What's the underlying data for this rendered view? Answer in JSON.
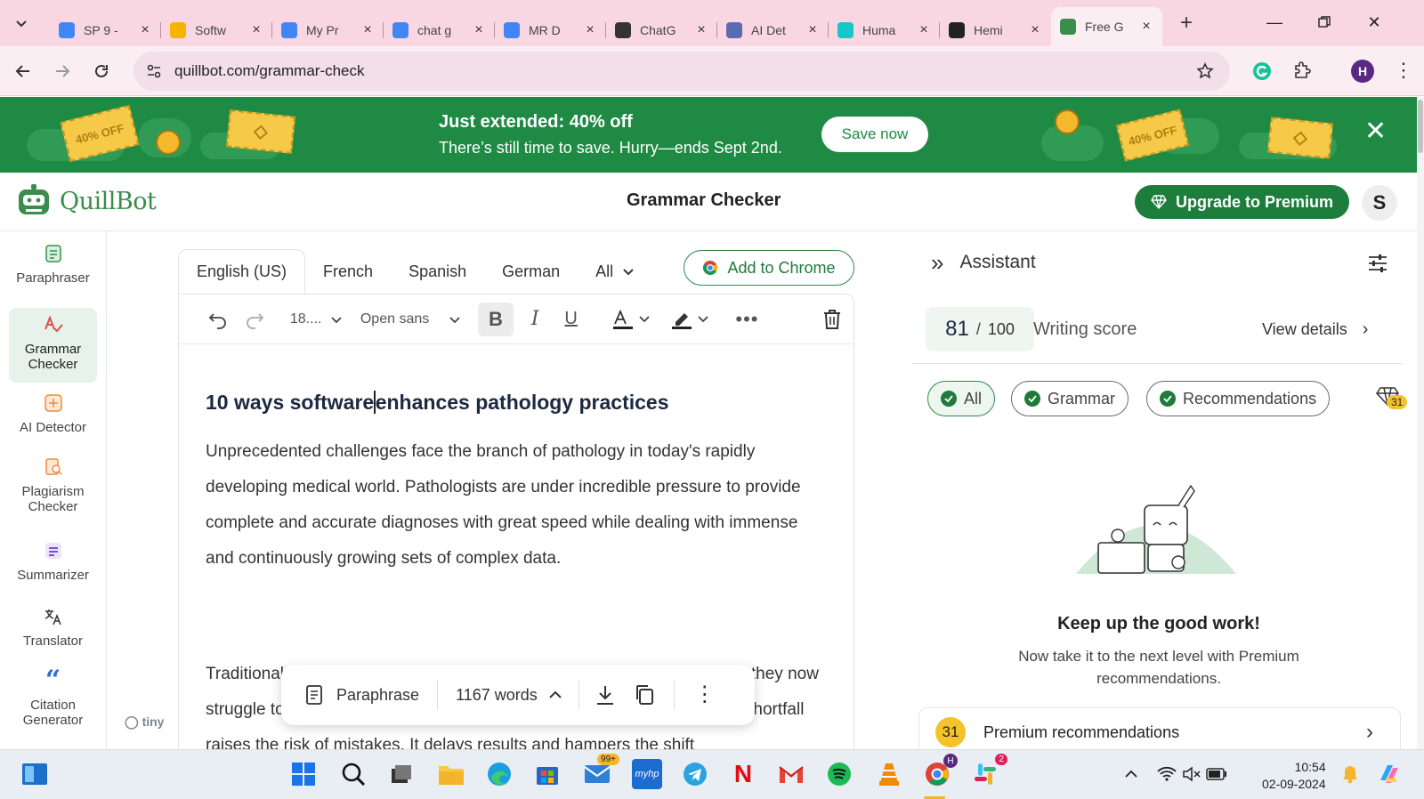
{
  "browser": {
    "tabs": [
      {
        "title": "SP 9 -",
        "icon": "google-g-icon",
        "color": "#4285f4"
      },
      {
        "title": "Softw",
        "icon": "notes-icon",
        "color": "#f4b400"
      },
      {
        "title": "My Pr",
        "icon": "google-docs-icon",
        "color": "#4285f4"
      },
      {
        "title": "chat g",
        "icon": "google-docs-icon",
        "color": "#4285f4"
      },
      {
        "title": "MR D",
        "icon": "google-docs-icon",
        "color": "#4285f4"
      },
      {
        "title": "ChatG",
        "icon": "openai-icon",
        "color": "#333333"
      },
      {
        "title": "AI Det",
        "icon": "ai-detector-icon",
        "color": "#5b6bb0"
      },
      {
        "title": "Huma",
        "icon": "humanizer-icon",
        "color": "#18c5c9"
      },
      {
        "title": "Hemi",
        "icon": "hemingway-icon",
        "color": "#222222"
      },
      {
        "title": "Free G",
        "icon": "quillbot-icon",
        "color": "#3a8d4a"
      }
    ],
    "url": "quillbot.com/grammar-check",
    "profile_initial": "H"
  },
  "banner": {
    "headline": "Just extended: 40% off",
    "subline": "There’s still time to save. Hurry—ends Sept 2nd.",
    "cta": "Save now",
    "ticket_text": "40% OFF"
  },
  "header": {
    "brand": "QuillBot",
    "title": "Grammar Checker",
    "upgrade": "Upgrade to Premium",
    "avatar": "S"
  },
  "sidebar": {
    "items": [
      {
        "label": "Paraphraser",
        "icon": "paraphraser-icon"
      },
      {
        "label": "Grammar Checker",
        "icon": "grammar-checker-icon"
      },
      {
        "label": "AI Detector",
        "icon": "ai-detector-icon"
      },
      {
        "label": "Plagiarism Checker",
        "icon": "plagiarism-checker-icon"
      },
      {
        "label": "Summarizer",
        "icon": "summarizer-icon"
      },
      {
        "label": "Translator",
        "icon": "translator-icon"
      },
      {
        "label": "Citation Generator",
        "icon": "citation-icon"
      }
    ],
    "tiny_label": "tiny"
  },
  "editor": {
    "languages": [
      "English (US)",
      "French",
      "Spanish",
      "German",
      "All"
    ],
    "add_chrome": "Add to Chrome",
    "font_size": "18....",
    "font_family": "Open sans",
    "heading_before_caret": "10 ways software",
    "heading_after_caret": "enhances pathology practices",
    "paragraph1": "Unprecedented challenges face the branch of pathology in today's rapidly developing medical world. Pathologists are under incredible pressure to provide complete and accurate diagnoses with great speed while dealing with immense and continuously growing sets of complex data.",
    "paragraph2": "Traditional methods were once the cornerstone of diagnostics. However, they now struggle to keep pace with the demands of modern pathology labs. This shortfall raises the risk of mistakes. It delays results and hampers the shift",
    "paraphrase": "Paraphrase",
    "word_count": "1167 words"
  },
  "assistant": {
    "title": "Assistant",
    "score": "81",
    "score_max": "100",
    "score_label": "Writing score",
    "view_details": "View details",
    "filters": [
      "All",
      "Grammar",
      "Recommendations"
    ],
    "premium_count": "31",
    "keep_title": "Keep up the good work!",
    "keep_sub": "Now take it to the next level with Premium recommendations.",
    "premium_rec": "Premium recommendations"
  },
  "taskbar": {
    "mail_badge": "99+",
    "slack_badge": "2",
    "time": "10:54",
    "date": "02-09-2024"
  }
}
